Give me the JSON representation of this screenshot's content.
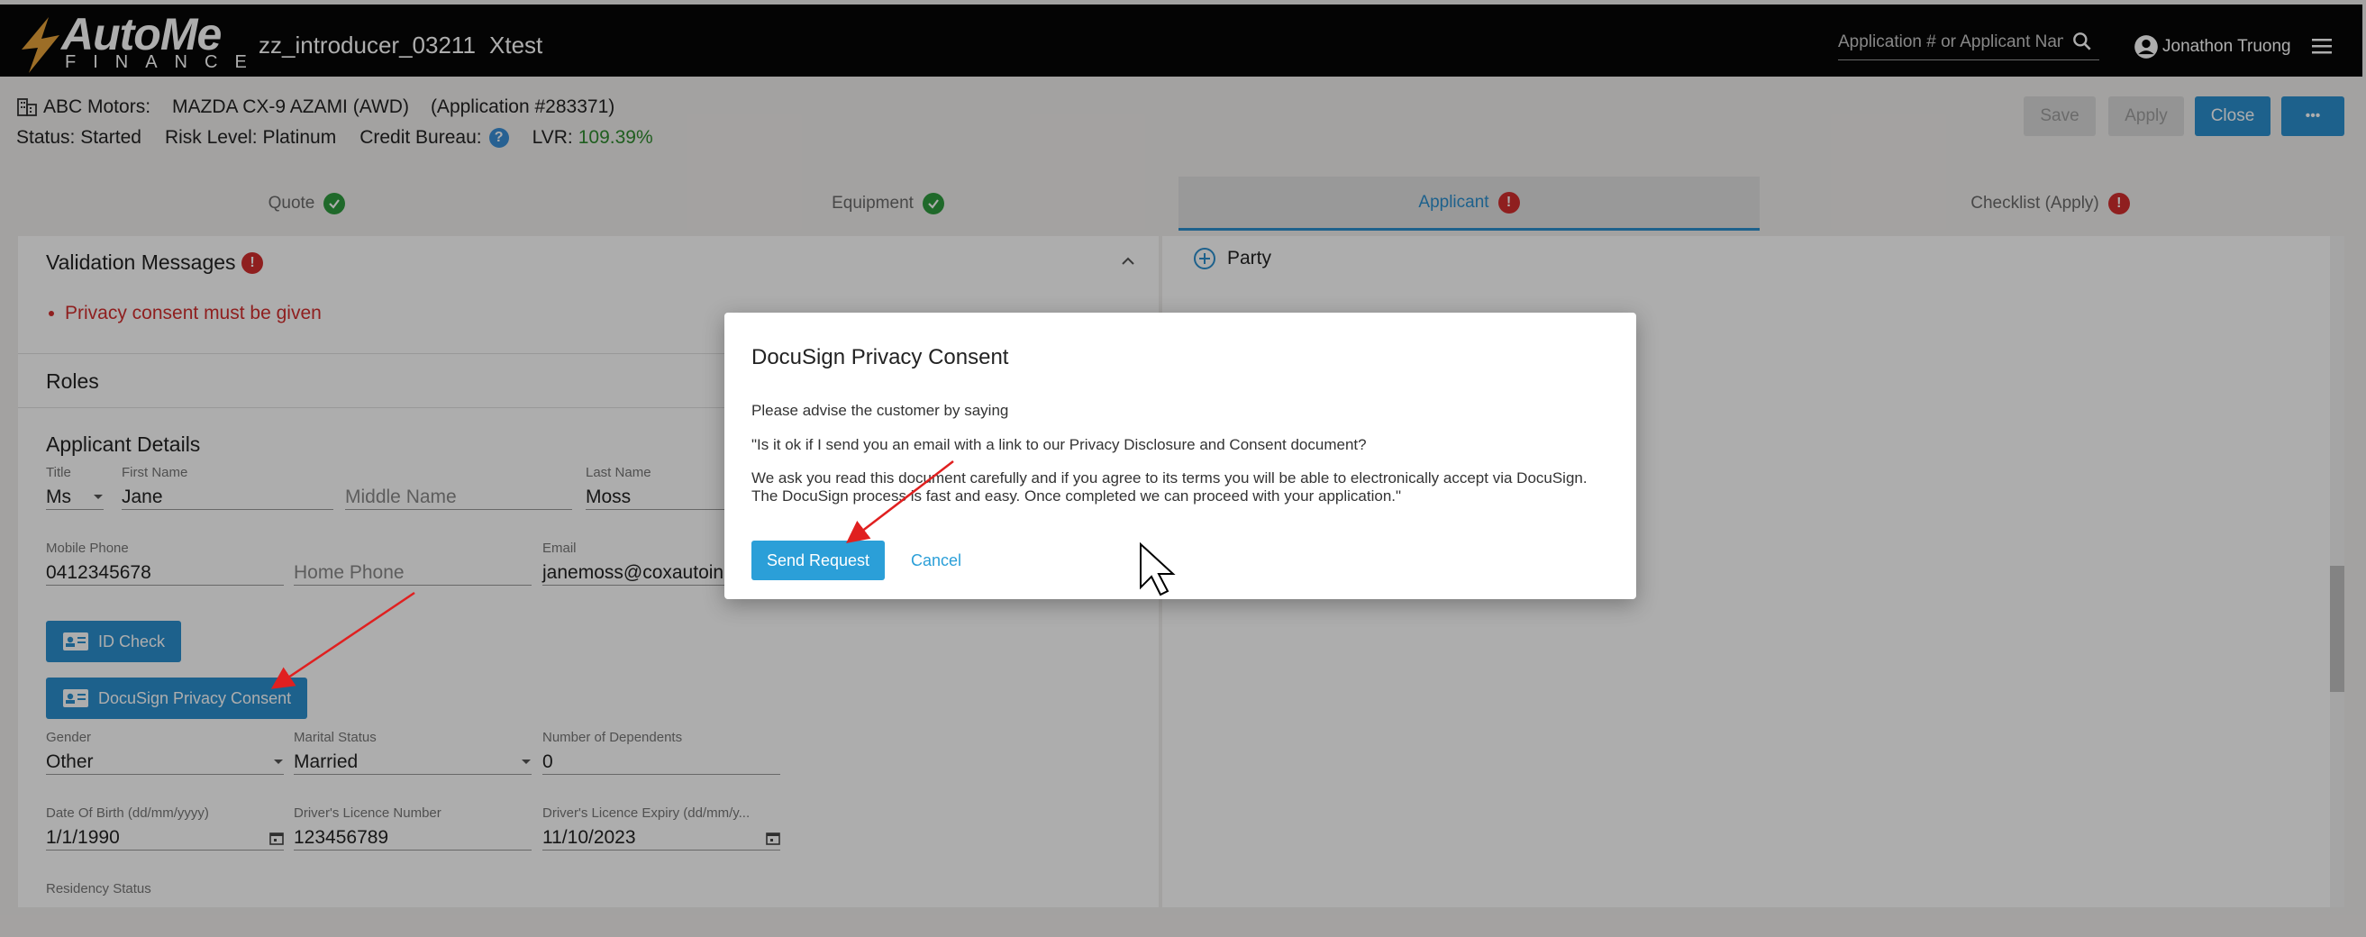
{
  "app": {
    "logo_text": "AutoMe",
    "logo_sub": "FINANCE",
    "app_code": "zz_introducer_03211",
    "env": "Xtest",
    "search_placeholder": "Application # or Applicant Name",
    "user_name": "Jonathon Truong"
  },
  "header": {
    "dealer": "ABC Motors:",
    "vehicle": "MAZDA CX-9 AZAMI (AWD)",
    "application": "(Application #283371)",
    "status_label": "Status:",
    "status_value": "Started",
    "risk_label": "Risk Level:",
    "risk_value": "Platinum",
    "credit_label": "Credit Bureau:",
    "credit_help": "?",
    "lvr_label": "LVR:",
    "lvr_value": "109.39%",
    "save_label": "Save",
    "apply_label": "Apply",
    "close_label": "Close",
    "more_label": "•••"
  },
  "tabs": [
    {
      "label": "Quote",
      "status": "ok"
    },
    {
      "label": "Equipment",
      "status": "ok"
    },
    {
      "label": "Applicant",
      "status": "error"
    },
    {
      "label": "Checklist (Apply)",
      "status": "error"
    }
  ],
  "left": {
    "validation_title": "Validation Messages",
    "validation_message": "Privacy consent must be given",
    "roles_title": "Roles",
    "applicant_title": "Applicant Details",
    "fields": {
      "title": {
        "label": "Title",
        "value": "Ms"
      },
      "first_name": {
        "label": "First Name",
        "value": "Jane"
      },
      "middle_name": {
        "placeholder": "Middle Name"
      },
      "last_name": {
        "label": "Last Name",
        "value": "Moss"
      },
      "mobile": {
        "label": "Mobile Phone",
        "value": "0412345678"
      },
      "home_phone": {
        "placeholder": "Home Phone"
      },
      "email": {
        "label": "Email",
        "value": "janemoss@coxautoinc"
      },
      "gender": {
        "label": "Gender",
        "value": "Other"
      },
      "marital": {
        "label": "Marital Status",
        "value": "Married"
      },
      "dependents": {
        "label": "Number of Dependents",
        "value": "0"
      },
      "dob": {
        "label": "Date Of Birth (dd/mm/yyyy)",
        "value": "1/1/1990"
      },
      "licence": {
        "label": "Driver's Licence Number",
        "value": "123456789"
      },
      "licence_expiry": {
        "label": "Driver's Licence Expiry (dd/mm/y...",
        "value": "11/10/2023"
      },
      "residency": {
        "label": "Residency Status"
      }
    },
    "id_check_label": "ID Check",
    "docusign_label": "DocuSign Privacy Consent"
  },
  "right": {
    "party_label": "Party"
  },
  "dialog": {
    "title": "DocuSign Privacy Consent",
    "line1": "Please advise the customer by saying",
    "line2": "\"Is it ok if I send you an email with a link to our Privacy Disclosure and Consent document?",
    "line3": "We ask you read this document carefully and if you agree to its terms you will be able to electronically accept via DocuSign. The DocuSign process is fast and easy. Once completed we can proceed with your application.\"",
    "send_label": "Send Request",
    "cancel_label": "Cancel"
  },
  "colors": {
    "accent": "#2b8fcf",
    "success": "#2e9b3e",
    "error": "#d32f2f",
    "annotation_arrow": "#e02020"
  }
}
